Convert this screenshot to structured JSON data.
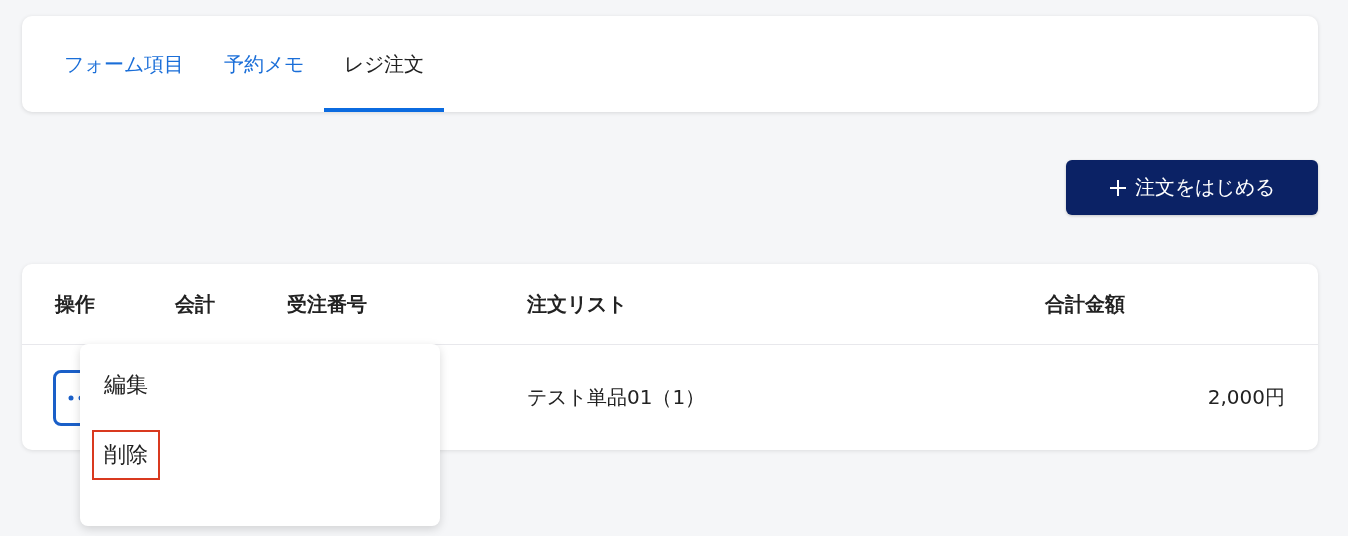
{
  "tabs": [
    {
      "label": "フォーム項目",
      "selected": false
    },
    {
      "label": "予約メモ",
      "selected": false
    },
    {
      "label": "レジ注文",
      "selected": true
    }
  ],
  "start_order_button": {
    "label": "注文をはじめる"
  },
  "table": {
    "columns": [
      "操作",
      "会計",
      "受注番号",
      "注文リスト",
      "合計金額"
    ],
    "rows": [
      {
        "cells": [
          "",
          "",
          "",
          "テスト単品01（1）",
          "2,000円"
        ]
      }
    ]
  },
  "action_menu": {
    "items": [
      {
        "label": "編集",
        "highlighted": false
      },
      {
        "label": "削除",
        "highlighted": true
      }
    ]
  }
}
